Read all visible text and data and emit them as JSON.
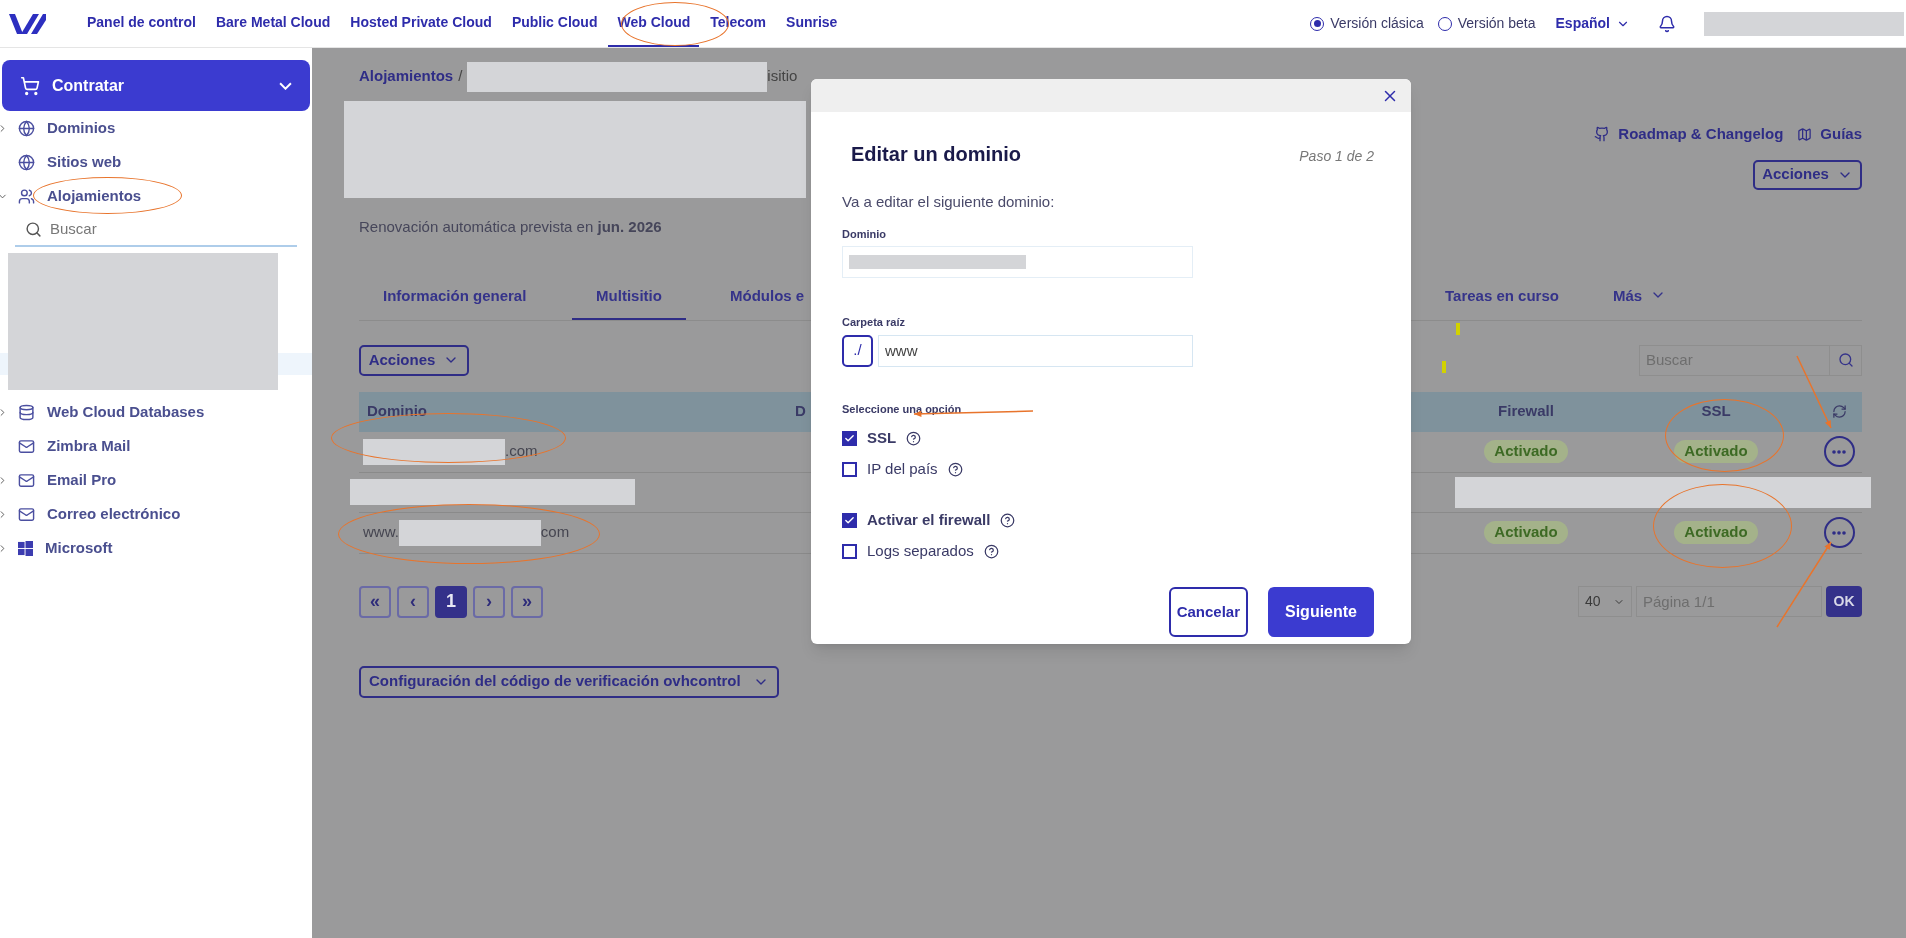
{
  "top_nav": {
    "items": [
      {
        "label": "Panel de control",
        "selected": false
      },
      {
        "label": "Bare Metal Cloud",
        "selected": false
      },
      {
        "label": "Hosted Private Cloud",
        "selected": false
      },
      {
        "label": "Public Cloud",
        "selected": false
      },
      {
        "label": "Web Cloud",
        "selected": true
      },
      {
        "label": "Telecom",
        "selected": false
      },
      {
        "label": "Sunrise",
        "selected": false
      }
    ],
    "versions": [
      {
        "label": "Versión clásica",
        "selected": true
      },
      {
        "label": "Versión beta",
        "selected": false
      }
    ],
    "language": "Español"
  },
  "sidebar": {
    "order_button": "Contratar",
    "items": [
      {
        "label": "Dominios",
        "kind": "group",
        "expanded": false
      },
      {
        "label": "Sitios web",
        "kind": "link"
      },
      {
        "label": "Alojamientos",
        "kind": "group",
        "expanded": true,
        "search_placeholder": "Buscar"
      },
      {
        "label": "Web Cloud Databases",
        "kind": "group",
        "expanded": false
      },
      {
        "label": "Zimbra Mail",
        "kind": "link"
      },
      {
        "label": "Email Pro",
        "kind": "group",
        "expanded": false
      },
      {
        "label": "Correo electrónico",
        "kind": "group",
        "expanded": false
      },
      {
        "label": "Microsoft",
        "kind": "group",
        "expanded": false
      }
    ]
  },
  "main": {
    "breadcrumb": {
      "link": "Alojamientos",
      "separator": "/",
      "tail": "isitio"
    },
    "header_links": [
      {
        "label": "Roadmap & Changelog"
      },
      {
        "label": "Guías"
      }
    ],
    "actions_button": "Acciones",
    "renewal": "Renovación automática prevista en **jun. 2026**",
    "tabs": [
      {
        "label": "Información general",
        "selected": false,
        "kind": "tab"
      },
      {
        "label": "Multisitio",
        "selected": true,
        "kind": "tab"
      },
      {
        "label": "Módulos e",
        "selected": false,
        "kind": "tab"
      },
      {
        "label": "Tareas en curso",
        "selected": false,
        "kind": "tab"
      },
      {
        "label": "Más",
        "selected": false,
        "kind": "menu"
      }
    ],
    "table_actions": "Acciones",
    "search": {
      "placeholder": "Buscar"
    },
    "table": {
      "columns": [
        "Dominio",
        "D",
        "Firewall",
        "SSL"
      ],
      "rows": [
        {
          "kind": "domain",
          "prefix": "",
          "suffix": ".com",
          "firewall": "Activado",
          "ssl": "Activado"
        },
        {
          "kind": "redacted"
        },
        {
          "kind": "domain",
          "prefix": "www.",
          "suffix": "com",
          "firewall": "Activado",
          "ssl": "Activado"
        }
      ]
    },
    "pagination": [
      {
        "label": "«",
        "selected": false
      },
      {
        "label": "‹",
        "selected": false
      },
      {
        "label": "1",
        "selected": true
      },
      {
        "label": "›",
        "selected": false
      },
      {
        "label": "»",
        "selected": false
      }
    ],
    "page_size": "40",
    "page_field": {
      "placeholder": "Página 1/1"
    },
    "ok_button": "OK",
    "verification_button": "Configuración del código de verificación ovhcontrol"
  },
  "modal": {
    "title": "Editar un dominio",
    "step": "Paso 1 de 2",
    "intro": "Va a editar el siguiente dominio:",
    "domain_label": "Dominio",
    "root_label": "Carpeta raíz",
    "root_prefix": "./",
    "root_value": "www",
    "options_label": "Seleccione una opción",
    "option_groups": [
      [
        {
          "label": "SSL",
          "checked": true
        },
        {
          "label": "IP del país",
          "checked": false
        }
      ],
      [
        {
          "label": "Activar el firewall",
          "checked": true
        },
        {
          "label": "Logs separados",
          "checked": false
        }
      ]
    ],
    "cancel": "Cancelar",
    "next": "Siguiente"
  }
}
